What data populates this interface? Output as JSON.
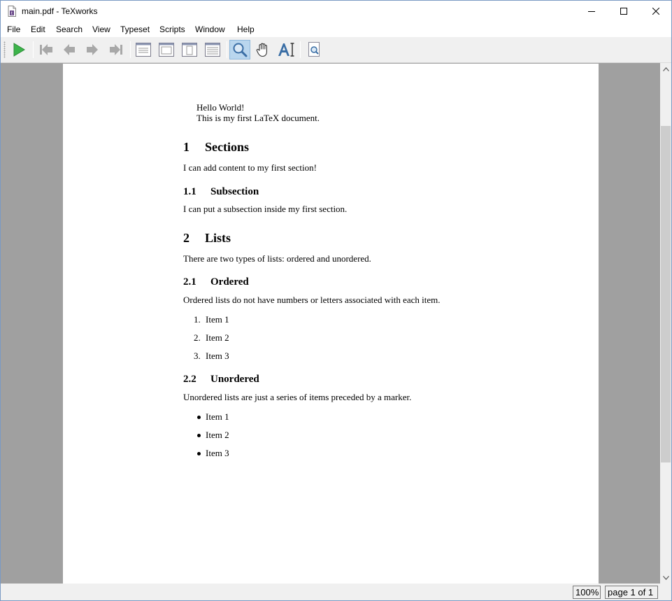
{
  "window": {
    "title": "main.pdf - TeXworks",
    "app_icon": "pdf-document-icon",
    "controls": [
      "minimize-icon",
      "maximize-icon",
      "close-icon"
    ]
  },
  "menu": [
    {
      "label": "File"
    },
    {
      "label": "Edit"
    },
    {
      "label": "Search"
    },
    {
      "label": "View"
    },
    {
      "label": "Typeset"
    },
    {
      "label": "Scripts"
    },
    {
      "label": "Window"
    },
    {
      "label": "Help"
    }
  ],
  "toolbar": {
    "buttons": [
      {
        "name": "typeset-icon",
        "active": false
      },
      {
        "name": "first-page-icon",
        "active": false
      },
      {
        "name": "previous-page-icon",
        "active": false
      },
      {
        "name": "next-page-icon",
        "active": false
      },
      {
        "name": "last-page-icon",
        "active": false
      },
      {
        "name": "actual-size-icon",
        "active": false
      },
      {
        "name": "fit-width-icon",
        "active": false
      },
      {
        "name": "fit-page-icon",
        "active": false
      },
      {
        "name": "fit-content-icon",
        "active": false
      },
      {
        "name": "magnify-icon",
        "active": true
      },
      {
        "name": "scroll-hand-icon",
        "active": false
      },
      {
        "name": "select-text-icon",
        "active": false
      },
      {
        "name": "go-to-source-icon",
        "active": false
      }
    ],
    "colors": {
      "accent_active": "#b9d6ee",
      "typeset_green": "#3cb44a"
    }
  },
  "document": {
    "intro": [
      "Hello World!",
      "This is my first LaTeX document."
    ],
    "sections": [
      {
        "num": "1",
        "title": "Sections"
      },
      {
        "num": "2",
        "title": "Lists"
      }
    ],
    "subsections": [
      {
        "num": "1.1",
        "title": "Subsection"
      },
      {
        "num": "2.1",
        "title": "Ordered"
      },
      {
        "num": "2.2",
        "title": "Unordered"
      }
    ],
    "paragraphs": [
      "I can add content to my first section!",
      "I can put a subsection inside my first section.",
      "There are two types of lists: ordered and unordered.",
      "Ordered lists do not have numbers or letters associated with each item.",
      "Unordered lists are just a series of items preceded by a marker."
    ],
    "ordered_list": [
      {
        "marker": "1.",
        "text": "Item 1"
      },
      {
        "marker": "2.",
        "text": "Item 2"
      },
      {
        "marker": "3.",
        "text": "Item 3"
      }
    ],
    "unordered_list": [
      "Item 1",
      "Item 2",
      "Item 3"
    ]
  },
  "status": {
    "zoom": "100%",
    "page_info": "page 1 of 1"
  }
}
